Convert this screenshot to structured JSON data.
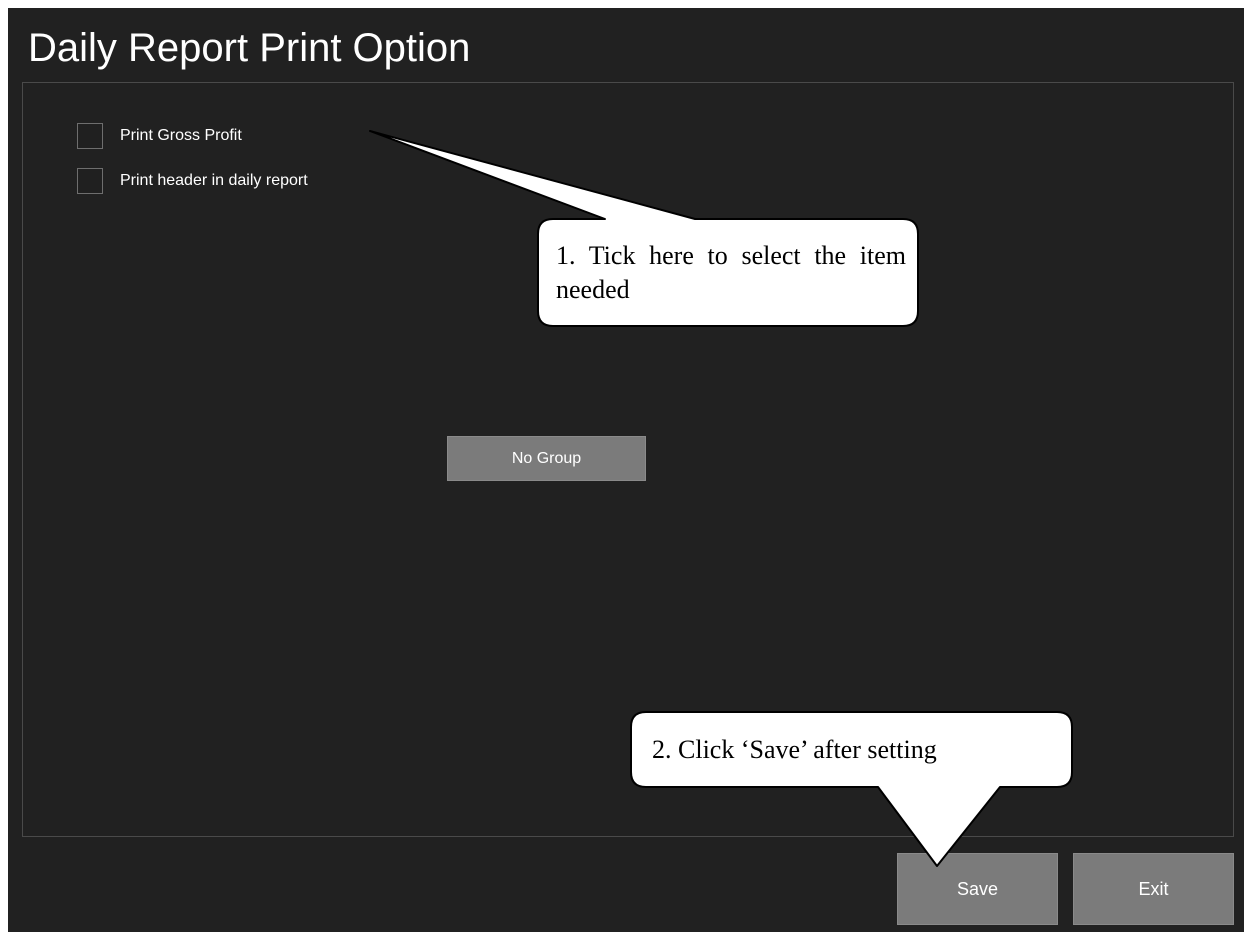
{
  "window": {
    "title": "Daily Report Print Option"
  },
  "options": [
    {
      "label": "Print Gross Profit",
      "checked": false
    },
    {
      "label": "Print header in daily report",
      "checked": false
    }
  ],
  "group_button": {
    "label": "No Group"
  },
  "footer": {
    "save_label": "Save",
    "exit_label": "Exit"
  },
  "callouts": {
    "tick_hint": "1. Tick here to select the item needed",
    "save_hint": "2. Click ‘Save’ after setting"
  },
  "colors": {
    "window_background": "#212121",
    "button_background": "#7b7b7b",
    "text": "#ffffff",
    "callout_background": "#ffffff"
  }
}
